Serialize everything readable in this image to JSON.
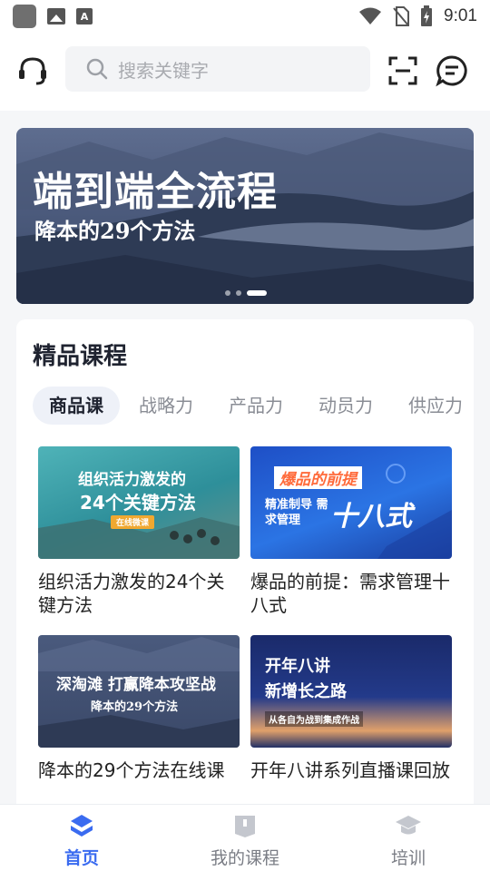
{
  "status_bar": {
    "time": "9:01"
  },
  "header": {
    "search_placeholder": "搜索关键字"
  },
  "banner": {
    "title": "端到端全流程",
    "subtitle": "降本的29个方法",
    "slide_count": 3,
    "active_slide": 3
  },
  "section": {
    "title": "精品课程",
    "tabs": [
      "商品课",
      "战略力",
      "产品力",
      "动员力",
      "供应力"
    ],
    "active_tab": 0
  },
  "courses": [
    {
      "name": "组织活力激发的24个关键方法",
      "thumb_line1": "组织活力激发的",
      "thumb_line2": "24个关键方法",
      "thumb_tag": "在线微课"
    },
    {
      "name": "爆品的前提：需求管理十八式",
      "thumb_line1": "爆品的前提",
      "thumb_line2": "精准制导 需求管理",
      "thumb_big": "十八式"
    },
    {
      "name": "降本的29个方法在线课",
      "thumb_line1": "深淘滩 打赢降本攻坚战",
      "thumb_line2": "降本的29个方法"
    },
    {
      "name": "开年八讲系列直播课回放",
      "thumb_line1": "开年八讲",
      "thumb_line2": "新增长之路",
      "thumb_line3": "从各自为战到集成作战"
    }
  ],
  "tabbar": {
    "items": [
      "首页",
      "我的课程",
      "培训"
    ],
    "active": 0,
    "accent_color": "#3a6bf0"
  }
}
